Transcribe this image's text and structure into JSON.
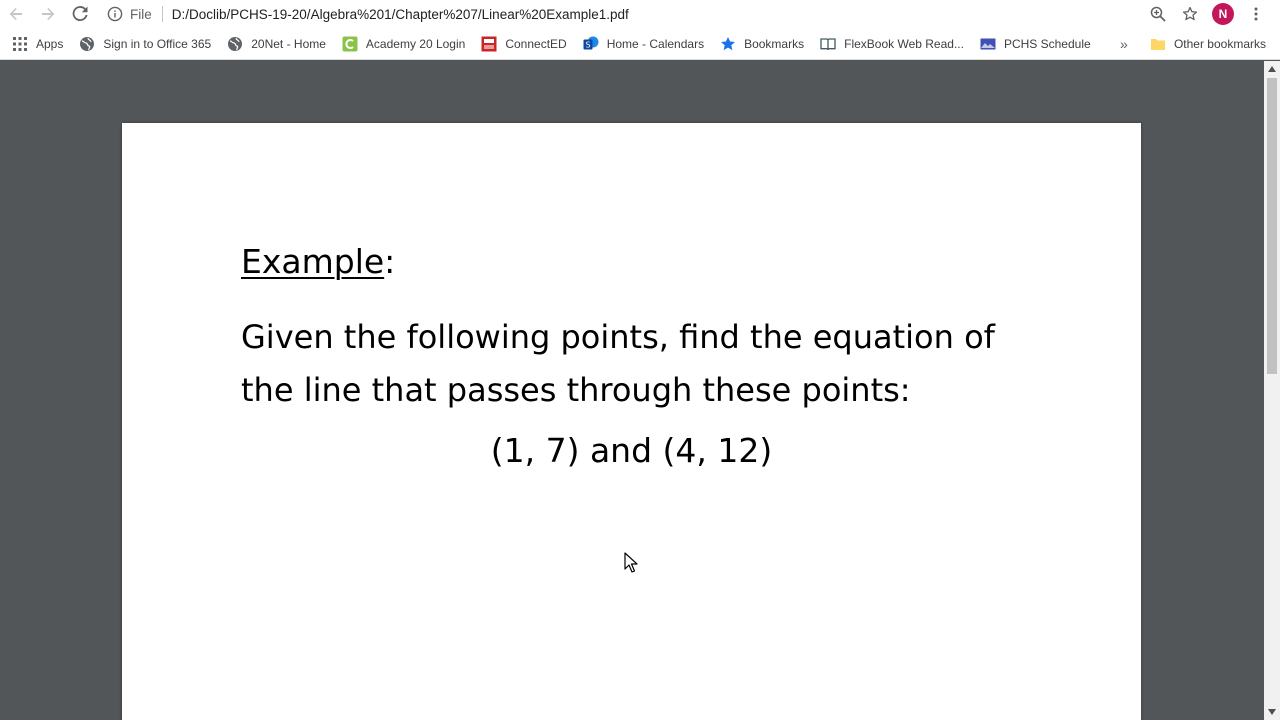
{
  "browser": {
    "url_scheme": "File",
    "url": "D:/Doclib/PCHS-19-20/Algebra%201/Chapter%207/Linear%20Example1.pdf",
    "avatar_letter": "N",
    "avatar_color": "#c2185b"
  },
  "bookmarks": {
    "items": [
      {
        "label": "Apps",
        "icon": "apps-grid-icon"
      },
      {
        "label": "Sign in to Office 365",
        "icon": "globe-icon"
      },
      {
        "label": "20Net - Home",
        "icon": "globe-icon"
      },
      {
        "label": "Academy 20 Login",
        "icon": "academy-icon"
      },
      {
        "label": "ConnectED",
        "icon": "connected-icon"
      },
      {
        "label": "Home - Calendars",
        "icon": "sharepoint-icon"
      },
      {
        "label": "Bookmarks",
        "icon": "star-icon"
      },
      {
        "label": "FlexBook Web Read...",
        "icon": "book-icon"
      },
      {
        "label": "PCHS Schedule",
        "icon": "schedule-icon"
      }
    ],
    "overflow": "»",
    "other_label": "Other bookmarks"
  },
  "document": {
    "heading_word": "Example",
    "heading_colon": ":",
    "body_line1": "Given the following points, find the equation of",
    "body_line2": "the line that passes through these points:",
    "points": "(1, 7) and (4, 12)"
  }
}
